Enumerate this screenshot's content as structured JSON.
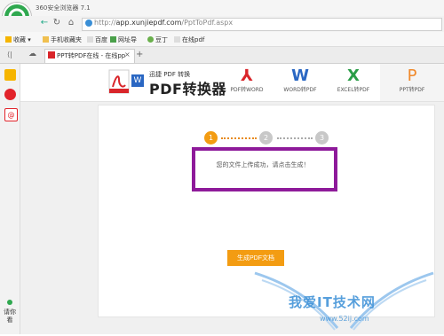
{
  "browser": {
    "title": "360安全浏览器 7.1",
    "url_host": "app.xunjiepdf.com",
    "url_prefix": "http://",
    "url_path": "/PptToPdf.aspx"
  },
  "bookmarks": [
    {
      "label": "收藏",
      "icon": "star-icon"
    },
    {
      "label": "手机收藏夹",
      "icon": "folder-icon"
    },
    {
      "label": "百度",
      "icon": "doc-icon"
    },
    {
      "label": "网址导",
      "icon": "chart-icon"
    },
    {
      "label": "豆丁",
      "icon": "ding-icon"
    },
    {
      "label": "在线pdf",
      "icon": "doc-icon"
    }
  ],
  "tab": {
    "label": "PPT转PDF在线 - 在线pp",
    "close": "×",
    "new": "+"
  },
  "brand": {
    "small": "迅捷 PDF 转换",
    "big": "PDF转换器"
  },
  "nav": [
    {
      "icon_char": "A",
      "label": "PDF转WORD",
      "color": "#d9252a"
    },
    {
      "icon_char": "W",
      "label": "WORD转PDF",
      "color": "#2a67c3"
    },
    {
      "icon_char": "X",
      "label": "EXCEL转PDF",
      "color": "#2a9d47"
    },
    {
      "icon_char": "P",
      "label": "PPT转PDF",
      "color": "#f0892b"
    }
  ],
  "steps": [
    "1",
    "2",
    "3"
  ],
  "message": "您的文件上传成功，请点击生成！",
  "generate_button": "生成PDF文档",
  "watermark": {
    "text": "我爱IT技术网",
    "sub": "www.52ij.com"
  },
  "sidebar_online": "请你看",
  "colors": {
    "accent": "#f39c12",
    "highlight": "#8e1a9a",
    "step_inactive": "#c8c8c8"
  }
}
